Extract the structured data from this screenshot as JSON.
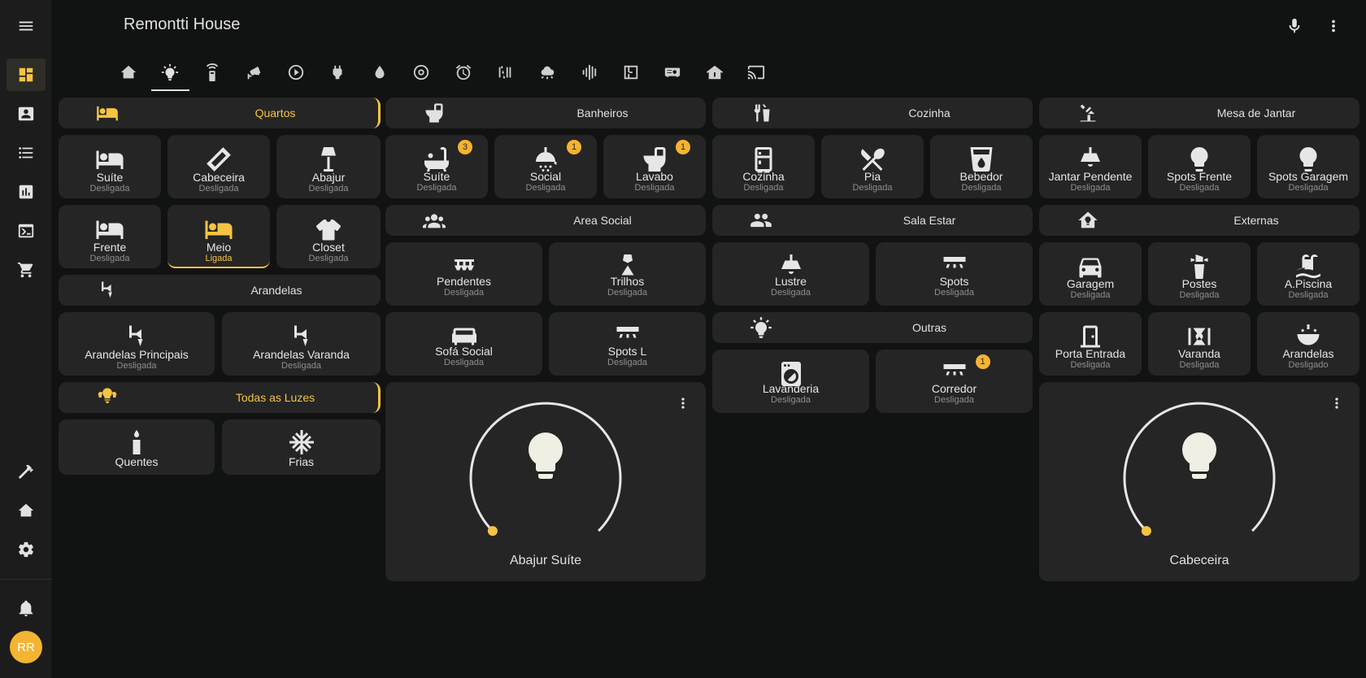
{
  "app": {
    "title": "Remontti House",
    "avatar_initials": "RR"
  },
  "sidebar": {
    "top_items": [
      "dashboard",
      "person-card",
      "list",
      "chart",
      "terminal",
      "cart"
    ],
    "bottom_items": [
      "hammer",
      "home-lightning",
      "settings"
    ],
    "notifications": "bell"
  },
  "tabs": [
    "home-lightning",
    "lightbulb",
    "remote",
    "cctv",
    "play-circle",
    "power-plug",
    "water",
    "robot-vacuum",
    "alarm-clock",
    "radiator",
    "weather-partly",
    "vibrate",
    "floor-plan",
    "projector",
    "home-roof",
    "cast"
  ],
  "columns": {
    "col1": {
      "quartos": {
        "label": "Quartos",
        "on": true
      },
      "quartos_buttons": [
        {
          "name": "Suíte",
          "state": "Desligada",
          "icon": "bed"
        },
        {
          "name": "Cabeceira",
          "state": "Desligada",
          "icon": "led-strip"
        },
        {
          "name": "Abajur",
          "state": "Desligada",
          "icon": "floor-lamp"
        },
        {
          "name": "Frente",
          "state": "Desligada",
          "icon": "bed"
        },
        {
          "name": "Meio",
          "state": "Ligada",
          "icon": "bed"
        },
        {
          "name": "Closet",
          "state": "Desligada",
          "icon": "tshirt"
        }
      ],
      "arandelas": {
        "label": "Arandelas"
      },
      "arandelas_buttons": [
        {
          "name": "Arandelas Principais",
          "state": "Desligada",
          "icon": "wall-sconce"
        },
        {
          "name": "Arandelas Varanda",
          "state": "Desligada",
          "icon": "wall-sconce"
        }
      ],
      "todas": {
        "label": "Todas as Luzes",
        "on": true
      },
      "todas_buttons": [
        {
          "name": "Quentes",
          "icon": "candle"
        },
        {
          "name": "Frias",
          "icon": "snowflake"
        }
      ]
    },
    "col2": {
      "banheiros": {
        "label": "Banheiros"
      },
      "banheiros_buttons": [
        {
          "name": "Suíte",
          "state": "Desligada",
          "icon": "bathtub",
          "badge": "3"
        },
        {
          "name": "Social",
          "state": "Desligada",
          "icon": "shower",
          "badge": "1"
        },
        {
          "name": "Lavabo",
          "state": "Desligada",
          "icon": "toilet",
          "badge": "1"
        }
      ],
      "area_social": {
        "label": "Area Social"
      },
      "area_buttons": [
        {
          "name": "Pendentes",
          "state": "Desligada",
          "icon": "chandelier"
        },
        {
          "name": "Trilhos",
          "state": "Desligada",
          "icon": "spotlight"
        },
        {
          "name": "Sofá Social",
          "state": "Desligada",
          "icon": "sofa"
        },
        {
          "name": "Spots L",
          "state": "Desligada",
          "icon": "ceiling-light"
        }
      ],
      "light_card": {
        "name": "Abajur Suíte",
        "brightness": 0
      }
    },
    "col3": {
      "cozinha": {
        "label": "Cozinha"
      },
      "cozinha_buttons": [
        {
          "name": "Cozinha",
          "state": "Desligada",
          "icon": "fridge"
        },
        {
          "name": "Pia",
          "state": "Desligada",
          "icon": "silverware"
        },
        {
          "name": "Bebedor",
          "state": "Desligada",
          "icon": "cup-water"
        }
      ],
      "sala_estar": {
        "label": "Sala Estar"
      },
      "sala_buttons": [
        {
          "name": "Lustre",
          "state": "Desligada",
          "icon": "ceiling-lamp"
        },
        {
          "name": "Spots",
          "state": "Desligada",
          "icon": "ceiling-light"
        }
      ],
      "outras": {
        "label": "Outras"
      },
      "outras_buttons": [
        {
          "name": "Lavanderia",
          "state": "Desligada",
          "icon": "washing-machine"
        },
        {
          "name": "Corredor",
          "state": "Desligada",
          "icon": "ceiling-light",
          "badge": "1"
        }
      ]
    },
    "col4": {
      "mesa": {
        "label": "Mesa de Jantar"
      },
      "mesa_buttons": [
        {
          "name": "Jantar Pendente",
          "state": "Desligada",
          "icon": "ceiling-lamp"
        },
        {
          "name": "Spots Frente",
          "state": "Desligada",
          "icon": "lightbulb"
        },
        {
          "name": "Spots Garagem",
          "state": "Desligada",
          "icon": "lightbulb"
        }
      ],
      "externas": {
        "label": "Externas"
      },
      "externas_buttons": [
        {
          "name": "Garagem",
          "state": "Desligada",
          "icon": "car"
        },
        {
          "name": "Postes",
          "state": "Desligada",
          "icon": "lighthouse"
        },
        {
          "name": "A.Piscina",
          "state": "Desligada",
          "icon": "pool"
        },
        {
          "name": "Porta Entrada",
          "state": "Desligada",
          "icon": "door"
        },
        {
          "name": "Varanda",
          "state": "Desligada",
          "icon": "outdoor-lamp"
        },
        {
          "name": "Arandelas",
          "state": "Desligado",
          "icon": "bowl-light"
        }
      ],
      "light_card": {
        "name": "Cabeceira",
        "brightness": 0
      }
    }
  },
  "colors": {
    "accent": "#f5c443",
    "card": "#252525",
    "background": "#111212"
  }
}
